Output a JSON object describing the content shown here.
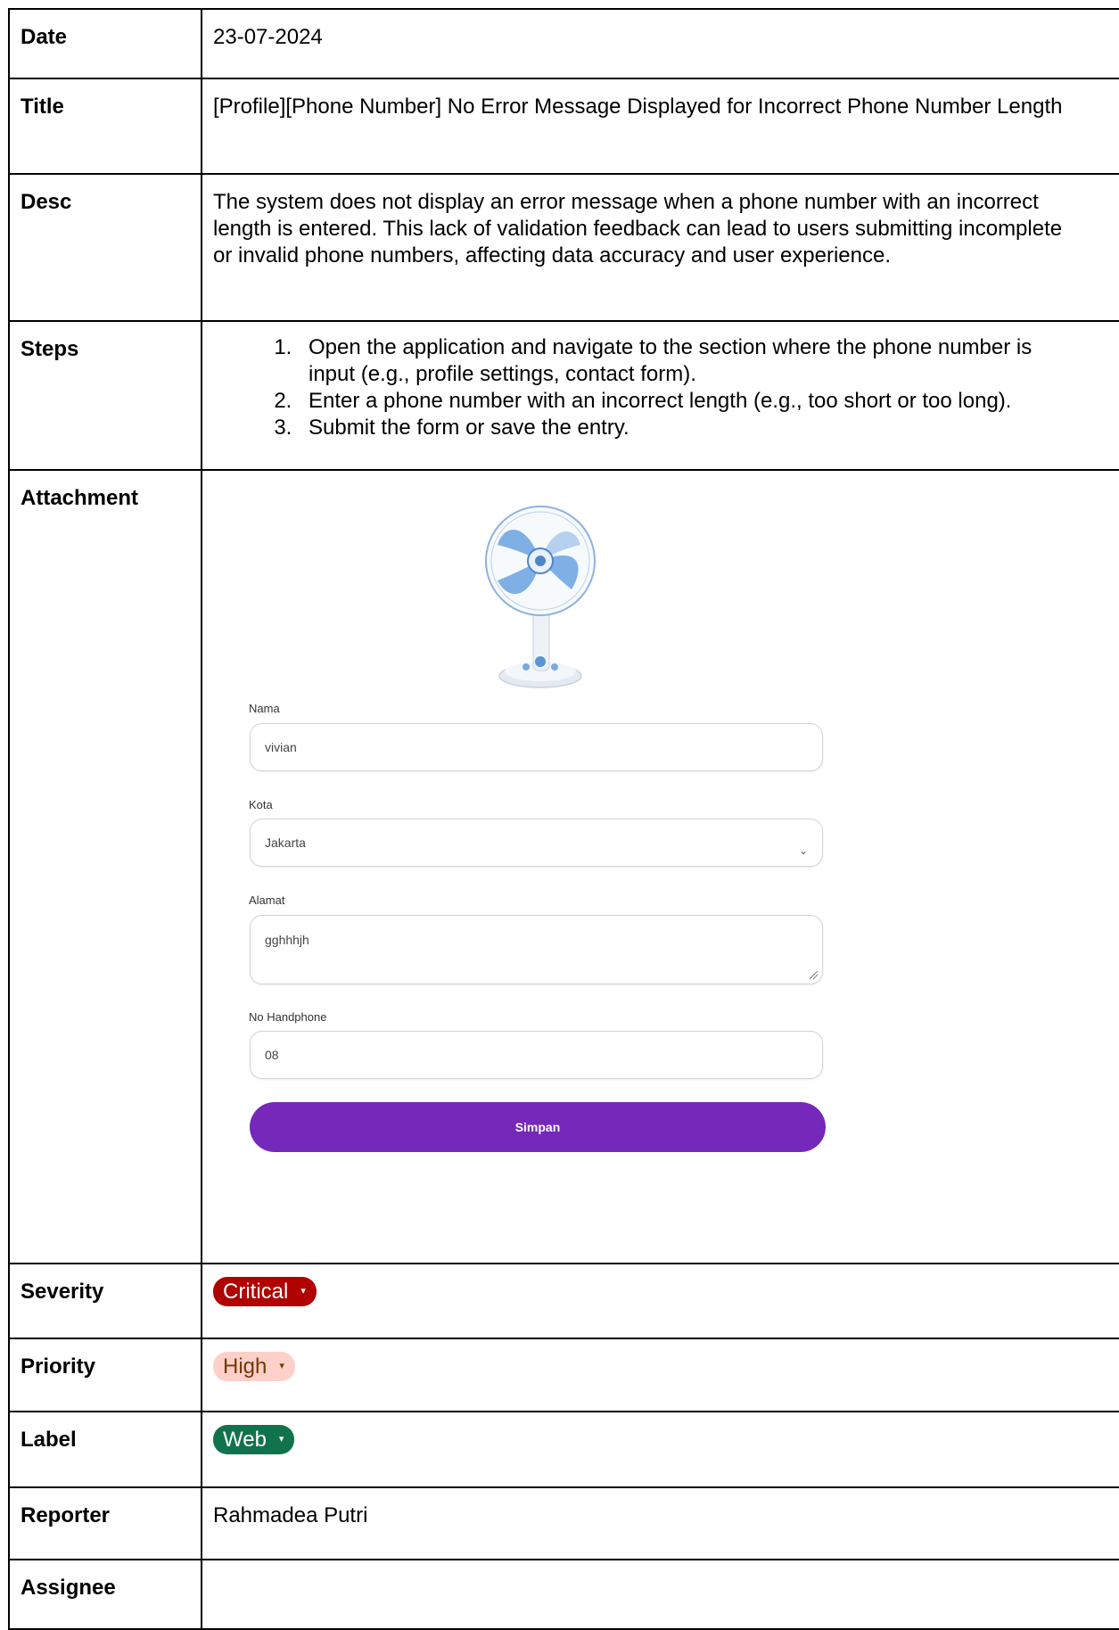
{
  "rows": {
    "date": {
      "label": "Date",
      "value": "23-07-2024"
    },
    "title": {
      "label": "Title",
      "value": "[Profile][Phone Number] No Error Message Displayed for Incorrect Phone Number Length"
    },
    "desc": {
      "label": "Desc",
      "value": "The system does not display an error message when a phone number with an incorrect length is entered. This lack of validation feedback can lead to users submitting incomplete or invalid phone numbers, affecting data accuracy and user experience."
    },
    "steps": {
      "label": "Steps",
      "items": [
        "Open the application and navigate to the section where the phone number is input (e.g., profile settings, contact form).",
        "Enter a phone number with an incorrect length (e.g., too short or too long).",
        "Submit the form or save the entry."
      ]
    },
    "attachment": {
      "label": "Attachment"
    },
    "severity": {
      "label": "Severity",
      "value": "Critical",
      "color": "#b10202"
    },
    "priority": {
      "label": "Priority",
      "value": "High",
      "color": "#ffcfc9"
    },
    "label": {
      "label": "Label",
      "value": "Web",
      "color": "#11734b"
    },
    "reporter": {
      "label": "Reporter",
      "value": "Rahmadea Putri"
    },
    "assignee": {
      "label": "Assignee",
      "value": ""
    }
  },
  "form": {
    "nama_label": "Nama",
    "nama_value": "vivian",
    "kota_label": "Kota",
    "kota_value": "Jakarta",
    "alamat_label": "Alamat",
    "alamat_value": "gghhhjh",
    "phone_label": "No Handphone",
    "phone_value": "08",
    "save_label": "Simpan",
    "accent": "#7528ba"
  },
  "icons": {
    "product_image": "desk-fan-icon",
    "dropdown": "chevron-down-icon"
  }
}
